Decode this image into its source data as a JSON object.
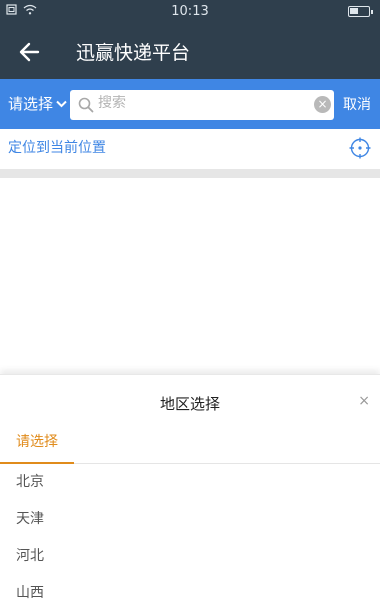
{
  "status_bar": {
    "time": "10:13"
  },
  "nav": {
    "title": "迅赢快递平台"
  },
  "search": {
    "region_label": "请选择",
    "placeholder": "搜索",
    "cancel_label": "取消"
  },
  "locate": {
    "label": "定位到当前位置"
  },
  "sheet": {
    "title": "地区选择",
    "close_glyph": "×",
    "active_tab": "请选择",
    "regions": [
      "北京",
      "天津",
      "河北",
      "山西"
    ]
  },
  "colors": {
    "nav": "#2f3f4d",
    "accent": "#3f86e4",
    "tab_active": "#e08b1b"
  }
}
